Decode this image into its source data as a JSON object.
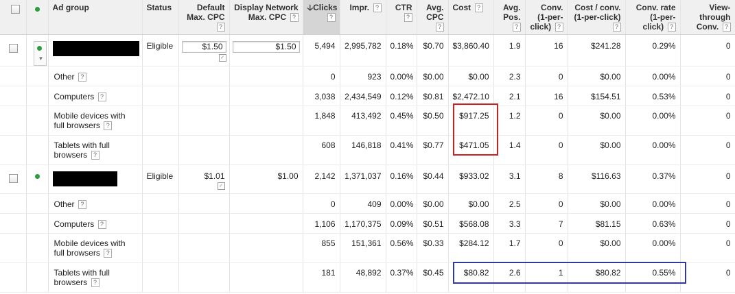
{
  "header": {
    "status_dot_color": "#2a9d3c",
    "columns": [
      {
        "label": "Ad group",
        "help": false
      },
      {
        "label": "Status",
        "help": false
      },
      {
        "label": "Default Max. CPC",
        "help": true
      },
      {
        "label": "Display Network Max. CPC",
        "help": true
      },
      {
        "label": "Clicks",
        "help": true,
        "sort_arrow": "🡣"
      },
      {
        "label": "Impr.",
        "help": true
      },
      {
        "label": "CTR",
        "help": true
      },
      {
        "label": "Avg. CPC",
        "help": true
      },
      {
        "label": "Cost",
        "help": true
      },
      {
        "label": "Avg. Pos.",
        "help": true
      },
      {
        "label": "Conv. (1-per-click)",
        "help": true
      },
      {
        "label": "Cost / conv. (1-per-click)",
        "help": true
      },
      {
        "label": "Conv. rate (1-per-click)",
        "help": true
      },
      {
        "label": "View-through Conv.",
        "help": true
      }
    ],
    "help_glyph": "?"
  },
  "groups": [
    {
      "status": "Eligible",
      "default_cpc": "$1.50",
      "display_cpc": "$1.50",
      "editable": true,
      "metrics": [
        "5,494",
        "2,995,782",
        "0.18%",
        "$0.70",
        "$3,860.40",
        "1.9",
        "16",
        "$241.28",
        "0.29%",
        "0"
      ],
      "devices": [
        {
          "label": "Other",
          "metrics": [
            "0",
            "923",
            "0.00%",
            "$0.00",
            "$0.00",
            "2.3",
            "0",
            "$0.00",
            "0.00%",
            "0"
          ]
        },
        {
          "label": "Computers",
          "metrics": [
            "3,038",
            "2,434,549",
            "0.12%",
            "$0.81",
            "$2,472.10",
            "2.1",
            "16",
            "$154.51",
            "0.53%",
            "0"
          ]
        },
        {
          "label": "Mobile devices with full browsers",
          "metrics": [
            "1,848",
            "413,492",
            "0.45%",
            "$0.50",
            "$917.25",
            "1.2",
            "0",
            "$0.00",
            "0.00%",
            "0"
          ]
        },
        {
          "label": "Tablets with full browsers",
          "metrics": [
            "608",
            "146,818",
            "0.41%",
            "$0.77",
            "$471.05",
            "1.4",
            "0",
            "$0.00",
            "0.00%",
            "0"
          ]
        }
      ]
    },
    {
      "status": "Eligible",
      "default_cpc": "$1.01",
      "display_cpc": "$1.00",
      "editable": false,
      "metrics": [
        "2,142",
        "1,371,037",
        "0.16%",
        "$0.44",
        "$933.02",
        "3.1",
        "8",
        "$116.63",
        "0.37%",
        "0"
      ],
      "devices": [
        {
          "label": "Other",
          "metrics": [
            "0",
            "409",
            "0.00%",
            "$0.00",
            "$0.00",
            "2.5",
            "0",
            "$0.00",
            "0.00%",
            "0"
          ]
        },
        {
          "label": "Computers",
          "metrics": [
            "1,106",
            "1,170,375",
            "0.09%",
            "$0.51",
            "$568.08",
            "3.3",
            "7",
            "$81.15",
            "0.63%",
            "0"
          ]
        },
        {
          "label": "Mobile devices with full browsers",
          "metrics": [
            "855",
            "151,361",
            "0.56%",
            "$0.33",
            "$284.12",
            "1.7",
            "0",
            "$0.00",
            "0.00%",
            "0"
          ]
        },
        {
          "label": "Tablets with full browsers",
          "metrics": [
            "181",
            "48,892",
            "0.37%",
            "$0.45",
            "$80.82",
            "2.6",
            "1",
            "$80.82",
            "0.55%",
            "0"
          ]
        }
      ]
    }
  ],
  "highlights": {
    "red_color": "#cc1f1f",
    "blue_color": "#2f3a9c"
  }
}
